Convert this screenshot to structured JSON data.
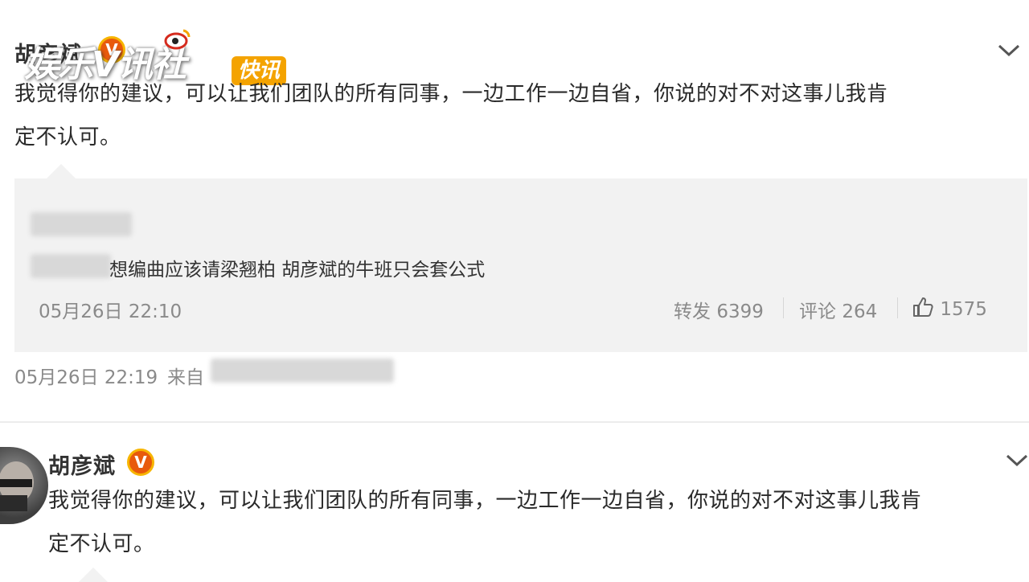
{
  "post1": {
    "username": "胡彦斌",
    "verified_badge": "V",
    "text_line1": "我觉得你的建议，可以让我们团队的所有同事，一边工作一边自省，你说的对不对这事儿我肯",
    "text_line2": "定不认可。",
    "quote": {
      "text_visible": "想编曲应该请梁翘柏 胡彦斌的牛班只会套公式",
      "timestamp": "05月26日 22:10",
      "repost_label": "转发",
      "repost_count": "6399",
      "comment_label": "评论",
      "comment_count": "264",
      "like_count": "1575"
    },
    "timestamp": "05月26日 22:19",
    "source_prefix": "来自"
  },
  "post2": {
    "username": "胡彦斌",
    "verified_badge": "V",
    "text_line1": "我觉得你的建议，可以让我们团队的所有同事，一边工作一边自省，你说的对不对这事儿我肯",
    "text_line2": "定不认可。"
  },
  "watermark": {
    "text": "娱乐V讯社",
    "tag": "快讯"
  },
  "icons": {
    "chevron": "chevron-down-icon",
    "like": "thumbs-up-icon",
    "watermark_logo": "weibo-logo-icon"
  },
  "colors": {
    "badge": "#e85a0c",
    "badge_ring": "#f7b500",
    "watermark_tag": "#f4a300",
    "meta_gray": "#8a8a8a",
    "quote_bg": "#f2f2f2"
  }
}
